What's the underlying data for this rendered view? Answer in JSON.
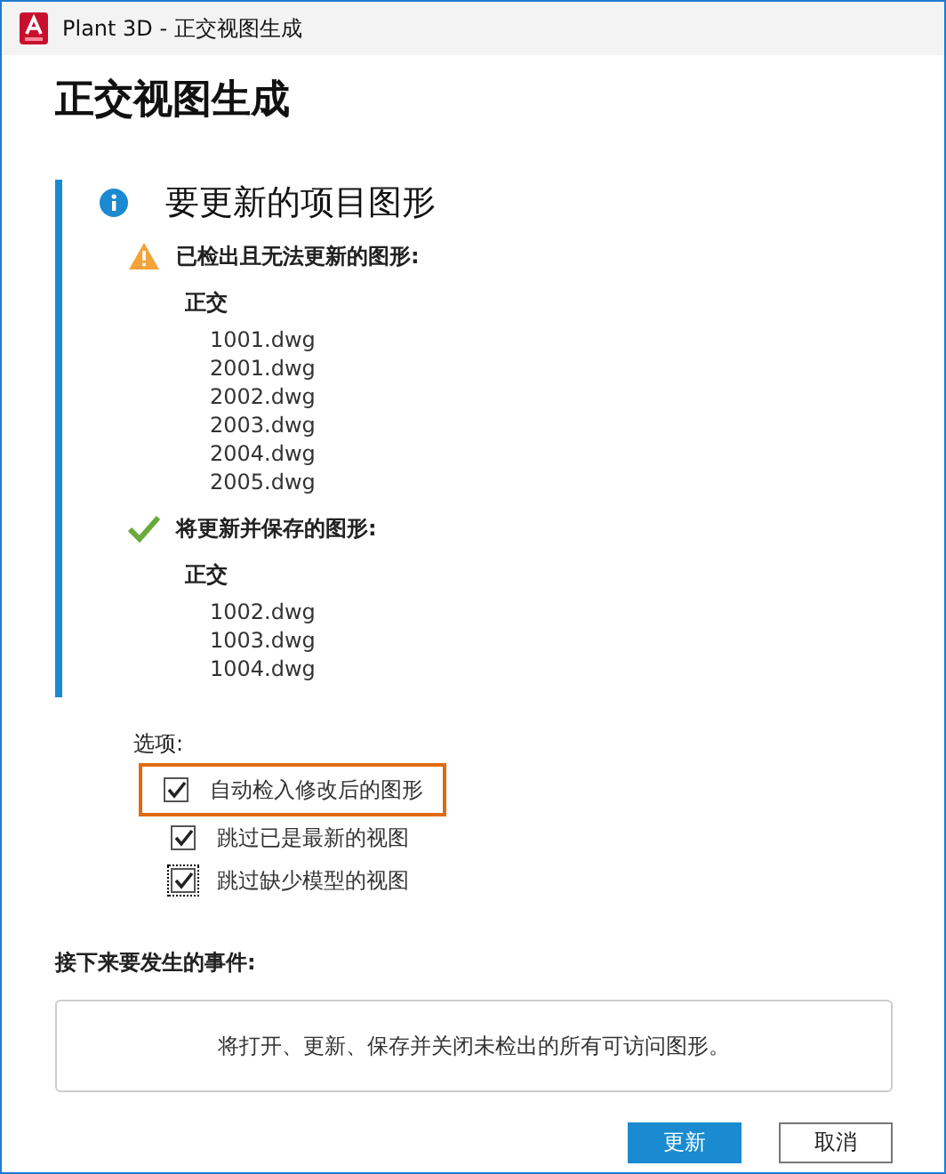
{
  "window": {
    "title": "Plant 3D - 正交视图生成"
  },
  "heading": "正交视图生成",
  "section": {
    "title": "要更新的项目图形",
    "groups": [
      {
        "kind": "warning",
        "label": "已检出且无法更新的图形:",
        "category": "正交",
        "files": [
          "1001.dwg",
          "2001.dwg",
          "2002.dwg",
          "2003.dwg",
          "2004.dwg",
          "2005.dwg"
        ]
      },
      {
        "kind": "success",
        "label": "将更新并保存的图形:",
        "category": "正交",
        "files": [
          "1002.dwg",
          "1003.dwg",
          "1004.dwg"
        ]
      }
    ]
  },
  "options": {
    "label": "选项:",
    "items": [
      {
        "label": "自动检入修改后的图形",
        "checked": true,
        "highlighted": true,
        "focused": false
      },
      {
        "label": "跳过已是最新的视图",
        "checked": true,
        "highlighted": false,
        "focused": false
      },
      {
        "label": "跳过缺少模型的视图",
        "checked": true,
        "highlighted": false,
        "focused": true
      }
    ]
  },
  "next": {
    "label": "接下来要发生的事件:",
    "message": "将打开、更新、保存并关闭未检出的所有可访问图形。"
  },
  "buttons": [
    {
      "label": "更新",
      "primary": true
    },
    {
      "label": "取消",
      "primary": false
    }
  ]
}
